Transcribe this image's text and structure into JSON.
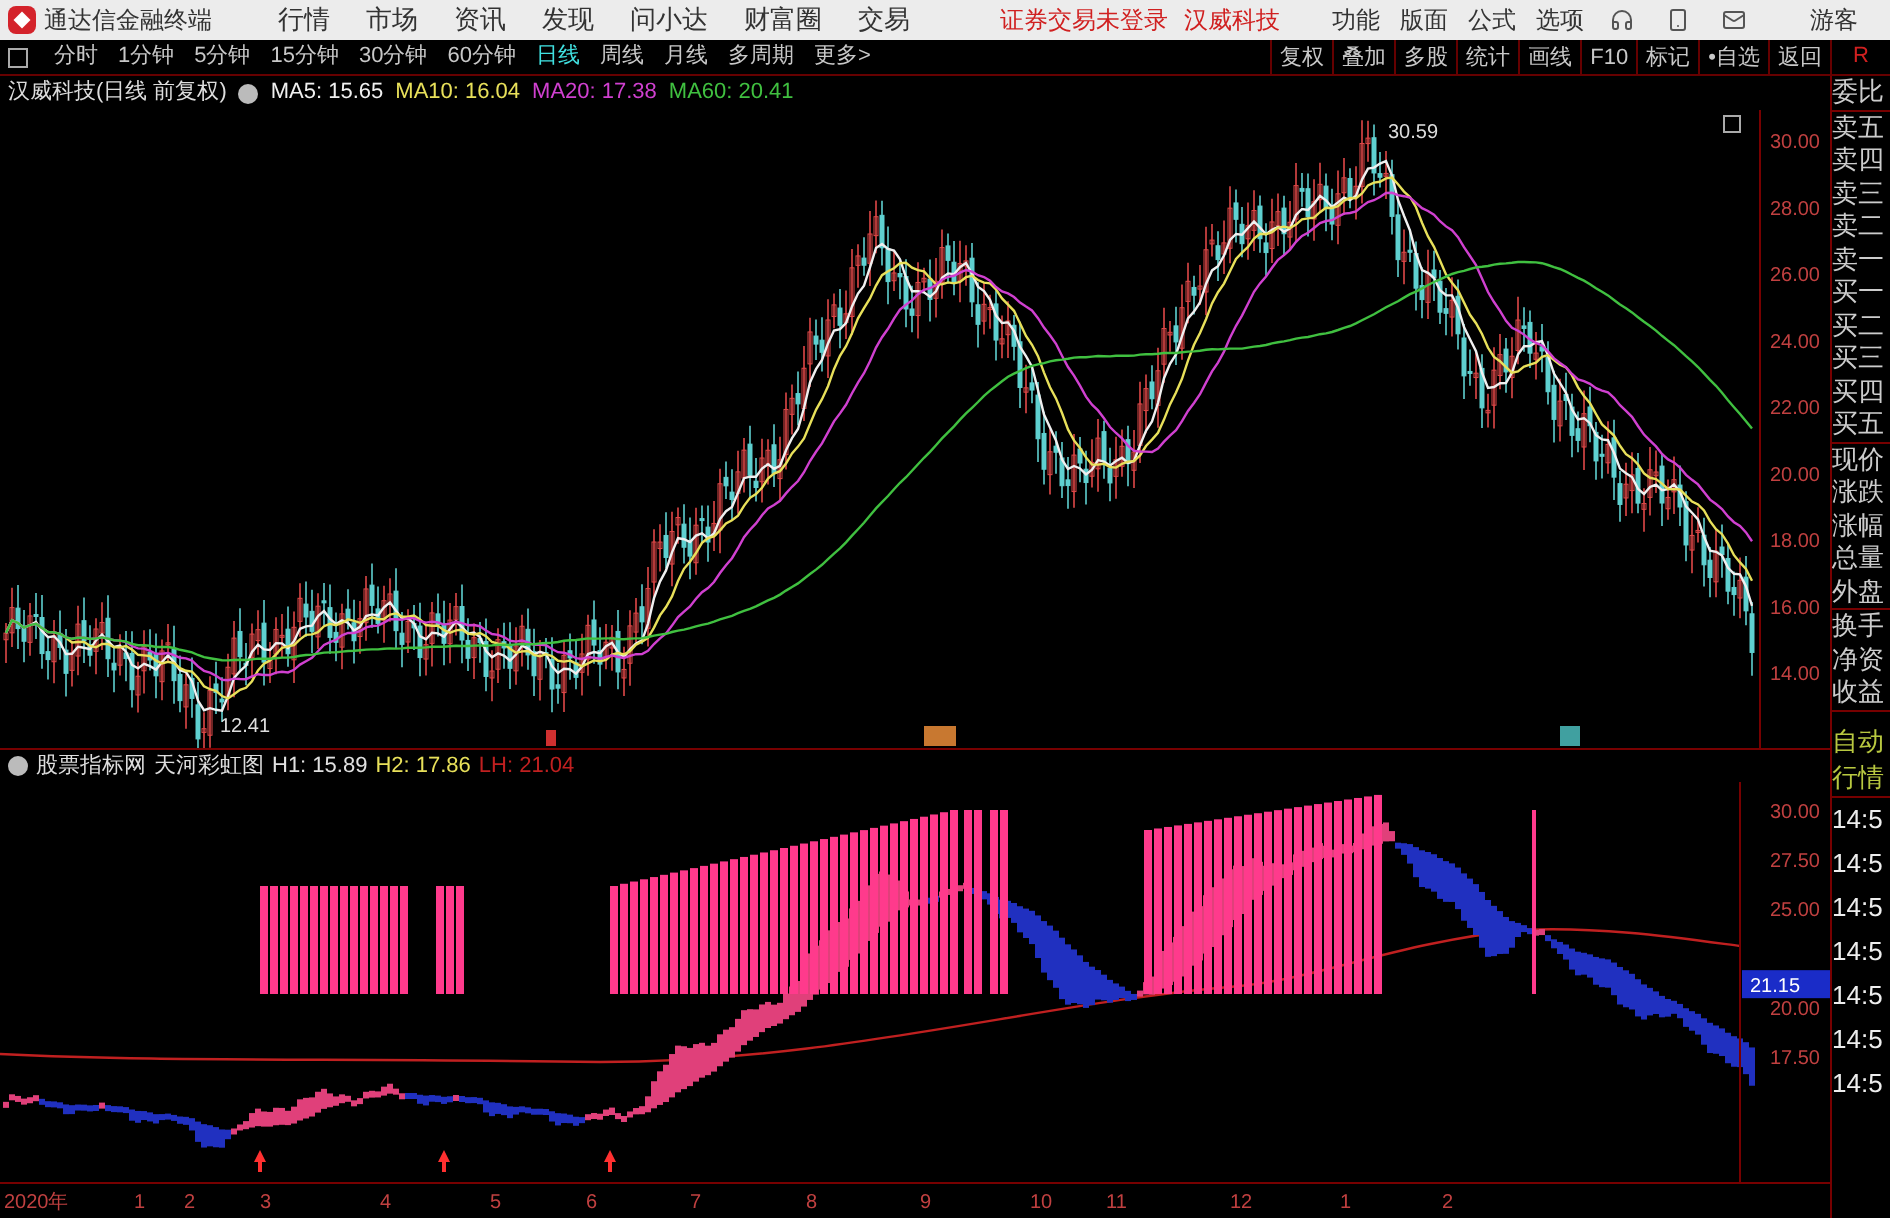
{
  "app": {
    "title": "通达信金融终端",
    "menu": [
      "行情",
      "市场",
      "资讯",
      "发现",
      "问小达",
      "财富圈",
      "交易"
    ],
    "login_notice": "证券交易未登录",
    "stock_link": "汉威科技",
    "right_menu": [
      "功能",
      "版面",
      "公式",
      "选项"
    ],
    "user": "游客"
  },
  "periods": [
    {
      "label": "分时",
      "selected": false
    },
    {
      "label": "1分钟",
      "selected": false
    },
    {
      "label": "5分钟",
      "selected": false
    },
    {
      "label": "15分钟",
      "selected": false
    },
    {
      "label": "30分钟",
      "selected": false
    },
    {
      "label": "60分钟",
      "selected": false
    },
    {
      "label": "日线",
      "selected": true
    },
    {
      "label": "周线",
      "selected": false
    },
    {
      "label": "月线",
      "selected": false
    },
    {
      "label": "多周期",
      "selected": false
    },
    {
      "label": "更多>",
      "selected": false
    }
  ],
  "tools": [
    "复权",
    "叠加",
    "多股",
    "统计",
    "画线",
    "F10",
    "标记",
    "•自选",
    "返回"
  ],
  "corner": "R",
  "price_chart": {
    "title": "汉威科技(日线 前复权)",
    "ma": [
      {
        "label": "MA5: 15.65",
        "color": "#f0f0f0"
      },
      {
        "label": "MA10: 16.04",
        "color": "#e8e05a"
      },
      {
        "label": "MA20: 17.38",
        "color": "#d040d0"
      },
      {
        "label": "MA60: 20.41",
        "color": "#40c040"
      }
    ],
    "y_labels": [
      "30.00",
      "28.00",
      "26.00",
      "24.00",
      "22.00",
      "20.00",
      "18.00",
      "16.00",
      "14.00"
    ],
    "high_label": "30.59",
    "low_label": "12.41"
  },
  "indicator": {
    "source": "股票指标网",
    "name": "天河彩虹图",
    "values": [
      {
        "label": "H1: 15.89",
        "color": "#e0e0e0"
      },
      {
        "label": "H2: 17.86",
        "color": "#e8e05a"
      },
      {
        "label": "LH: 21.04",
        "color": "#c02020"
      }
    ],
    "y_labels": [
      "30.00",
      "27.50",
      "25.00",
      "20.00",
      "17.50"
    ],
    "current": "21.15"
  },
  "x_axis": [
    "2020年",
    "1",
    "2",
    "3",
    "4",
    "5",
    "6",
    "7",
    "8",
    "9",
    "10",
    "11",
    "12",
    "1",
    "2"
  ],
  "quote_groups": [
    [
      "委比"
    ],
    [
      "卖五",
      "卖四",
      "卖三",
      "卖二",
      "卖一",
      "买一",
      "买二",
      "买三",
      "买四",
      "买五"
    ],
    [
      "现价",
      "涨跌",
      "涨幅",
      "总量",
      "外盘"
    ],
    [
      "换手",
      "净资",
      "收益"
    ]
  ],
  "time_panel": {
    "mode": [
      "自动",
      "行情"
    ],
    "times": [
      "14:5",
      "14:5",
      "14:5",
      "14:5",
      "14:5",
      "14:5",
      "14:5"
    ]
  }
}
